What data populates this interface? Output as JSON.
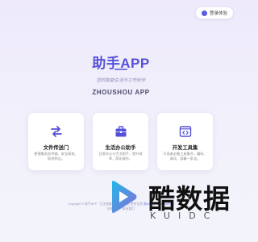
{
  "header": {
    "login_label": "登录体验",
    "login_icon": "user-circle-icon"
  },
  "hero": {
    "title": "助手APP",
    "subtitle": "您的智能生活与工作伙伴",
    "english_name": "ZHOUSHOU APP"
  },
  "cards": [
    {
      "icon": "exchange-arrows-icon",
      "title": "文件传送门",
      "description": "便捷服务务传输、安全高效、即刻到达。"
    },
    {
      "icon": "briefcase-icon",
      "title": "生活办公助手",
      "description": "日常办公与生活助手，提升效率，简化操作。"
    },
    {
      "icon": "code-window-icon",
      "title": "开发工具集",
      "description": "开发者必备工具集合，编码、调试、部署一条龙。"
    }
  ],
  "footer": {
    "line1_prefix": "Copyright © 助手APP · 已注册商标 | 备案信息 更多信息 ",
    "line1_link": "浙ICP备00000000号-1",
    "line2": "技术支持 · 联系我们"
  },
  "watermark": {
    "main_text": "酷数据",
    "sub_text": "KUIDC",
    "accent_color": "#22b8e8",
    "accent_color_2": "#8a6bd8"
  },
  "colors": {
    "brand": "#5451d8",
    "background": "#eeeafb",
    "card_bg": "#ffffff"
  }
}
